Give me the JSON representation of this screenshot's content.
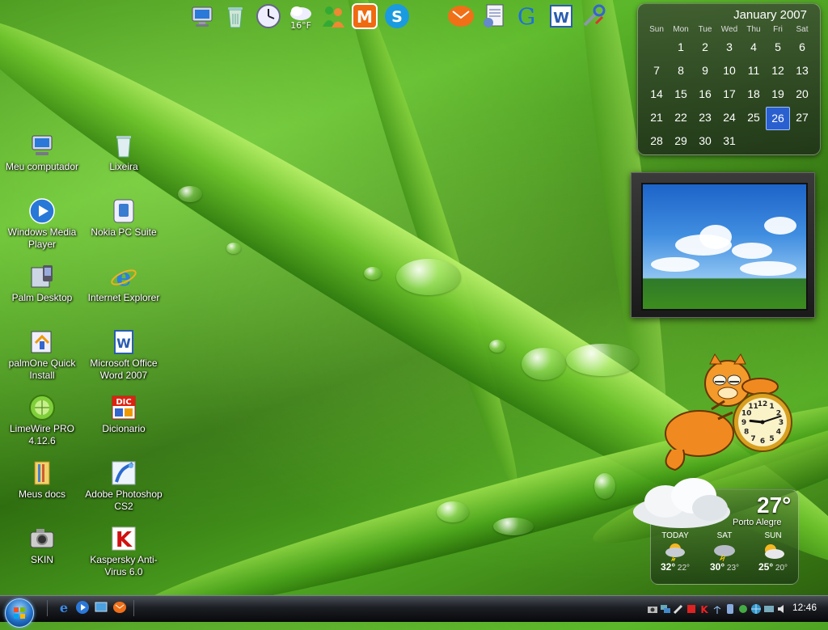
{
  "dock": {
    "weather_temp": "16°F",
    "icons": [
      "computer-icon",
      "recycle-bin-icon",
      "clock-icon",
      "weather-icon",
      "messenger-icon",
      "m-app-icon",
      "skype-icon",
      "mail-icon",
      "documents-icon",
      "google-icon",
      "word-icon",
      "tools-icon"
    ]
  },
  "desktop": {
    "icons": [
      {
        "label": "Meu computador",
        "icon": "computer-icon"
      },
      {
        "label": "Lixeira",
        "icon": "recycle-bin-icon"
      },
      {
        "label": "Windows Media Player",
        "icon": "media-player-icon"
      },
      {
        "label": "Nokia PC Suite",
        "icon": "nokia-icon"
      },
      {
        "label": "Palm Desktop",
        "icon": "palm-icon"
      },
      {
        "label": "Internet Explorer",
        "icon": "internet-explorer-icon"
      },
      {
        "label": "palmOne Quick Install",
        "icon": "palm-install-icon"
      },
      {
        "label": "Microsoft Office Word 2007",
        "icon": "word-icon"
      },
      {
        "label": "LimeWire PRO 4.12.6",
        "icon": "limewire-icon"
      },
      {
        "label": "Dicionario",
        "icon": "dictionary-icon"
      },
      {
        "label": "Meus docs",
        "icon": "folder-icon"
      },
      {
        "label": "Adobe Photoshop CS2",
        "icon": "photoshop-icon"
      },
      {
        "label": "SKIN",
        "icon": "camera-icon"
      },
      {
        "label": "Kaspersky Anti-Virus 6.0",
        "icon": "kaspersky-icon"
      }
    ]
  },
  "calendar": {
    "month_title": "January 2007",
    "weekdays": [
      "Sun",
      "Mon",
      "Tue",
      "Wed",
      "Thu",
      "Fri",
      "Sat"
    ],
    "days": [
      "",
      "1",
      "2",
      "3",
      "4",
      "5",
      "6",
      "7",
      "8",
      "9",
      "10",
      "11",
      "12",
      "13",
      "14",
      "15",
      "16",
      "17",
      "18",
      "19",
      "20",
      "21",
      "22",
      "23",
      "24",
      "25",
      "26",
      "27",
      "28",
      "29",
      "30",
      "31"
    ],
    "today": "26"
  },
  "clock": {
    "hour": 9,
    "minute": 12
  },
  "weather": {
    "current_temp": "27°",
    "city": "Porto Alegre",
    "forecast": [
      {
        "day": "TODAY",
        "high": "32°",
        "low": "22°",
        "icon": "storm-sun-icon"
      },
      {
        "day": "SAT",
        "high": "30°",
        "low": "23°",
        "icon": "storm-icon"
      },
      {
        "day": "SUN",
        "high": "25°",
        "low": "20°",
        "icon": "partly-cloudy-icon"
      }
    ]
  },
  "taskbar": {
    "time": "12:46",
    "quick_launch": [
      "internet-explorer-icon",
      "media-player-icon",
      "desktop-icon",
      "mail-icon"
    ]
  },
  "colors": {
    "today_highlight": "#2a5fcf",
    "taskbar": "#1b1e23"
  }
}
